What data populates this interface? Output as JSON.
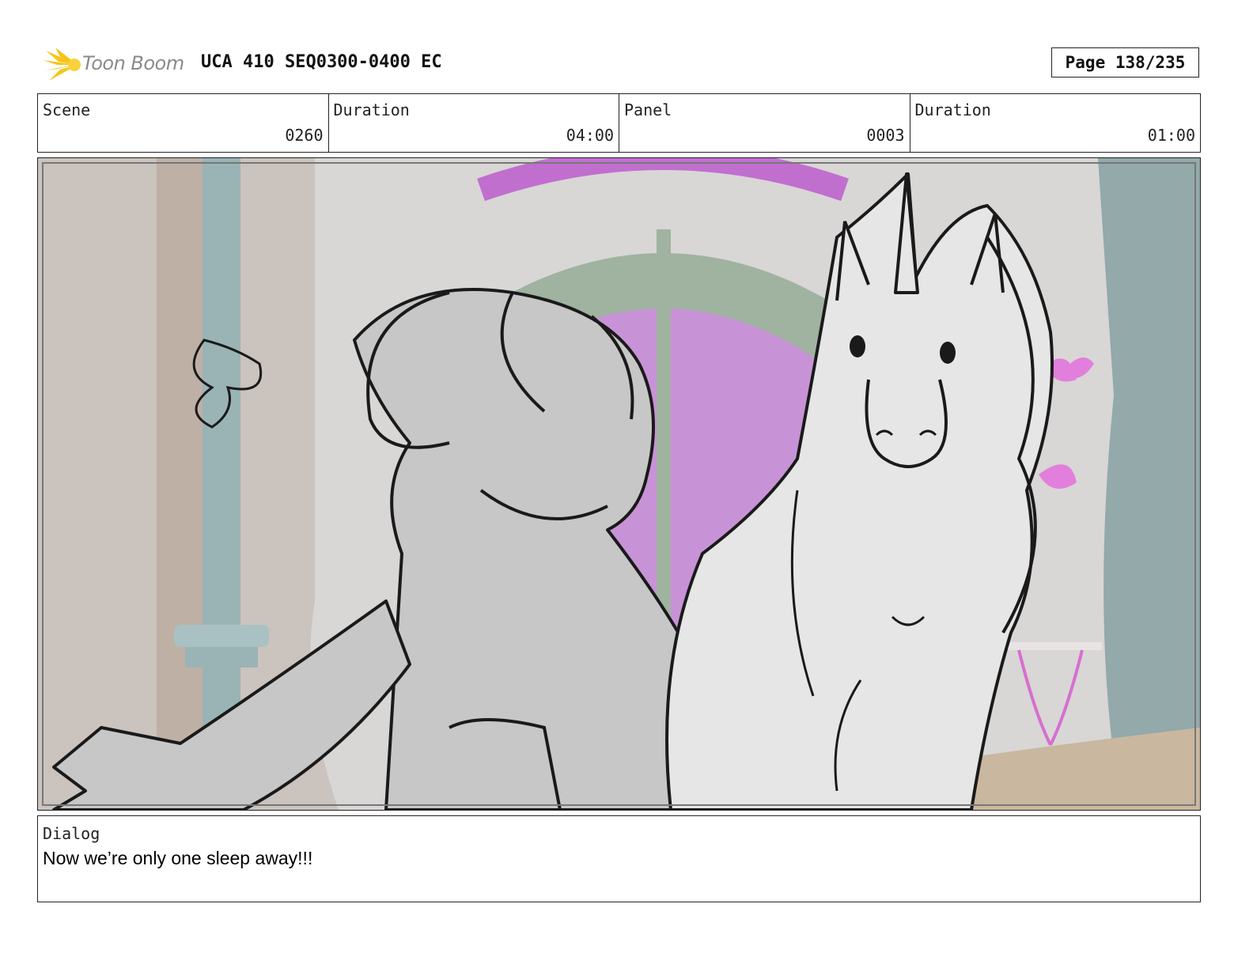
{
  "header": {
    "logo_text": "Toon Boom",
    "title": "UCA 410 SEQ0300-0400 EC",
    "page": "Page 138/235"
  },
  "info": {
    "scene_label": "Scene",
    "scene_value": "0260",
    "duration_label": "Duration",
    "duration_value": "04:00",
    "panel_label": "Panel",
    "panel_value": "0003",
    "panel_duration_label": "Duration",
    "panel_duration_value": "01:00"
  },
  "dialog": {
    "label": "Dialog",
    "text": "Now we’re only one sleep away!!!"
  },
  "colors": {
    "logo_accent": "#f5c518",
    "window_glass": "#c893d6",
    "arch_frame": "#9fb3a0",
    "wall": "#d9d6d6",
    "pillar": "#9ab4b6",
    "curtain": "#93a9aa",
    "butterfly": "#e27fdc",
    "girl_fill": "#c7c7c7",
    "unicorn_fill": "#e6e6e6",
    "line": "#1a1a1a"
  }
}
